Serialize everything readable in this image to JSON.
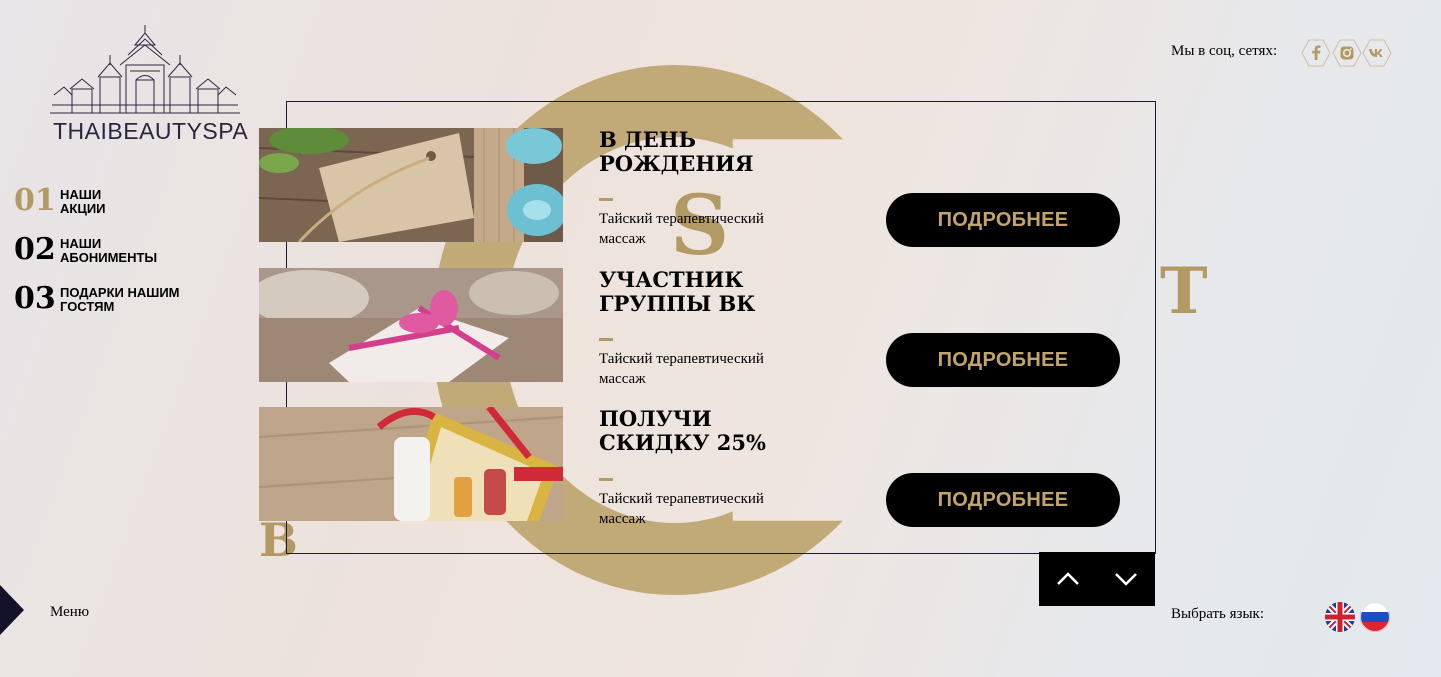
{
  "brand": {
    "name": "THAIBEAUTYSPA"
  },
  "nav": [
    {
      "num": "01",
      "label_line1": "НАШИ",
      "label_line2": "АКЦИИ"
    },
    {
      "num": "02",
      "label_line1": "НАШИ",
      "label_line2": "АБОНИМЕНТЫ"
    },
    {
      "num": "03",
      "label_line1": "ПОДАРКИ НАШИМ",
      "label_line2": "ГОСТЯМ"
    }
  ],
  "decor_letters": {
    "s": "S",
    "t": "T",
    "b": "B"
  },
  "offers": [
    {
      "title_line1": "В ДЕНЬ",
      "title_line2": "РОЖДЕНИЯ",
      "desc_line1": "Тайский терапевтический",
      "desc_line2": "массаж",
      "button": "ПОДРОБНЕЕ"
    },
    {
      "title_line1": "УЧАСТНИК",
      "title_line2": "ГРУППЫ ВК",
      "desc_line1": "Тайский терапевтический",
      "desc_line2": "массаж",
      "button": "ПОДРОБНЕЕ"
    },
    {
      "title_line1": "ПОЛУЧИ",
      "title_line2": "СКИДКУ 25%",
      "desc_line1": "Тайский терапевтический",
      "desc_line2": "массаж",
      "button": "ПОДРОБНЕЕ"
    }
  ],
  "social": {
    "label": "Мы в соц, сетях:",
    "icons": [
      "facebook-icon",
      "instagram-icon",
      "vk-icon"
    ]
  },
  "menu": {
    "label": "Меню"
  },
  "language": {
    "label": "Выбрать язык:",
    "options": [
      "english-flag-icon",
      "russian-flag-icon"
    ]
  },
  "colors": {
    "accent_gold": "#b39a64",
    "button_bg": "#000000",
    "button_text": "#c2a46c",
    "frame": "#1b1838"
  }
}
